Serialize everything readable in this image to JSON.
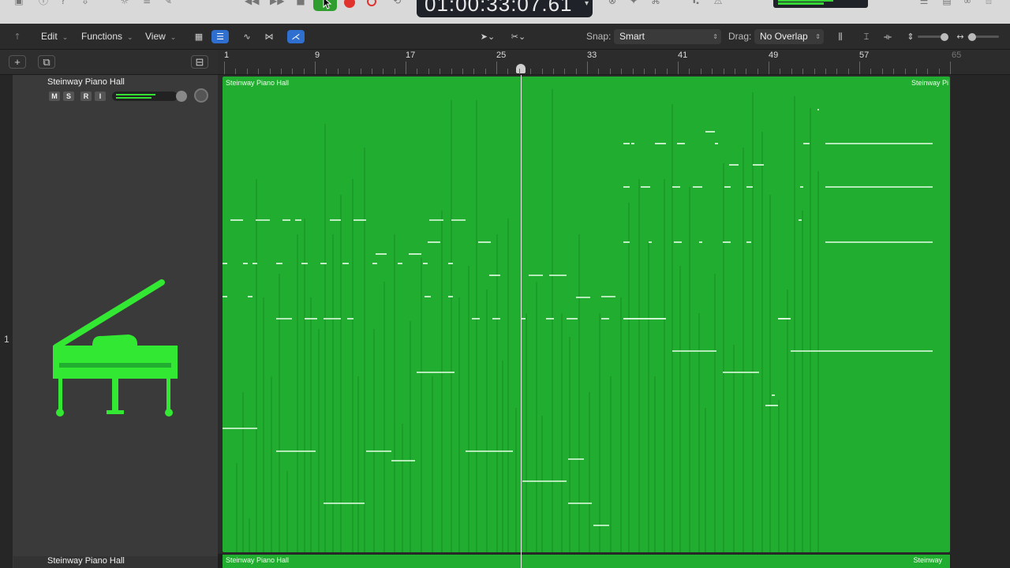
{
  "transport": {
    "time_display": "01:00:33:07.61",
    "play_active": true
  },
  "toolbar": {
    "edit_label": "Edit",
    "functions_label": "Functions",
    "view_label": "View",
    "snap_label": "Snap:",
    "snap_value": "Smart",
    "drag_label": "Drag:",
    "drag_value": "No Overlap"
  },
  "tracks": [
    {
      "number": "1",
      "name": "Steinway Piano Hall",
      "buttons": [
        "M",
        "S",
        "R",
        "I"
      ]
    },
    {
      "name": "Steinway Piano Hall"
    }
  ],
  "ruler": {
    "bars": [
      "1",
      "9",
      "17",
      "25",
      "33",
      "41",
      "49",
      "57",
      "65"
    ]
  },
  "regions": [
    {
      "name": "Steinway Piano Hall",
      "name_right": "Steinway Pi"
    },
    {
      "name": "Steinway Piano Hall",
      "name_right": "Steinway"
    }
  ],
  "colors": {
    "region": "#21ad2f",
    "playhead": "#e6e6e6",
    "accent": "#2f6fd0",
    "record": "#e0332d"
  }
}
